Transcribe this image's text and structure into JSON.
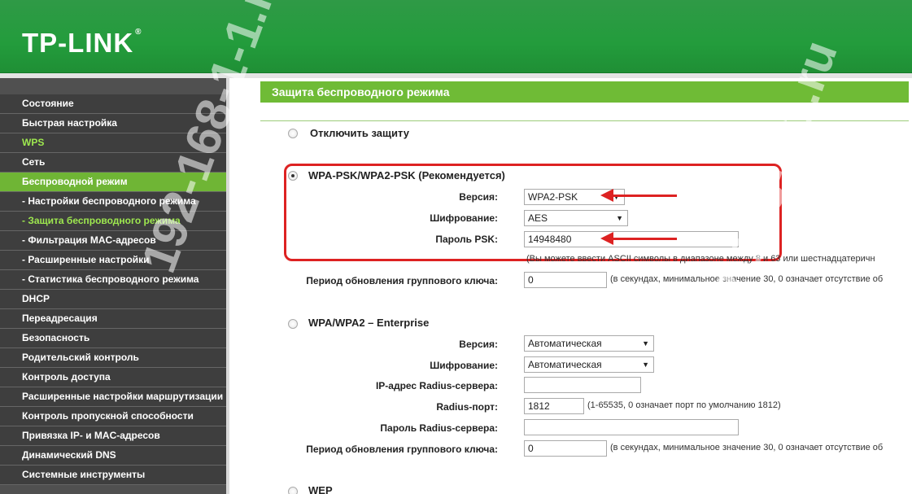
{
  "brand": {
    "logo": "TP-LINK",
    "trademark": "®"
  },
  "sidebar": {
    "items": [
      {
        "label": "Состояние"
      },
      {
        "label": "Быстрая настройка"
      },
      {
        "label": "WPS"
      },
      {
        "label": "Сеть"
      },
      {
        "label": "Беспроводной режим"
      },
      {
        "label": "- Настройки беспроводного режима"
      },
      {
        "label": "- Защита беспроводного режима"
      },
      {
        "label": "- Фильтрация MAC-адресов"
      },
      {
        "label": "- Расширенные настройки"
      },
      {
        "label": "- Статистика беспроводного режима"
      },
      {
        "label": "DHCP"
      },
      {
        "label": "Переадресация"
      },
      {
        "label": "Безопасность"
      },
      {
        "label": "Родительский контроль"
      },
      {
        "label": "Контроль доступа"
      },
      {
        "label": "Расширенные настройки маршрутизации"
      },
      {
        "label": "Контроль пропускной способности"
      },
      {
        "label": "Привязка IP- и MAC-адресов"
      },
      {
        "label": "Динамический DNS"
      },
      {
        "label": "Системные инструменты"
      }
    ]
  },
  "main": {
    "title": "Защита беспроводного режима",
    "disable": {
      "label": "Отключить защиту"
    },
    "wpa_psk": {
      "label": "WPA-PSK/WPA2-PSK (Рекомендуется)",
      "version_label": "Версия:",
      "version_value": "WPA2-PSK",
      "encryption_label": "Шифрование:",
      "encryption_value": "AES",
      "password_label": "Пароль PSK:",
      "password_value": "14948480",
      "password_hint": "(Вы можете ввести ASCII символы в диапазоне между 8 и 63 или шестнадцатеричн",
      "group_key_label": "Период обновления группового ключа:",
      "group_key_value": "0",
      "group_key_hint": "(в секундах, минимальное значение 30, 0 означает отсутствие об"
    },
    "enterprise": {
      "label": "WPA/WPA2 – Enterprise",
      "version_label": "Версия:",
      "version_value": "Автоматическая",
      "encryption_label": "Шифрование:",
      "encryption_value": "Автоматическая",
      "radius_ip_label": "IP-адрес Radius-сервера:",
      "radius_ip_value": "",
      "radius_port_label": "Radius-порт:",
      "radius_port_value": "1812",
      "radius_port_hint": "(1-65535, 0 означает порт по умолчанию 1812)",
      "radius_pass_label": "Пароль Radius-сервера:",
      "radius_pass_value": "",
      "group_key_label": "Период обновления группового ключа:",
      "group_key_value": "0",
      "group_key_hint": "(в секундах, минимальное значение 30, 0 означает отсутствие об"
    },
    "wep": {
      "label": "WEP"
    }
  },
  "watermark": "192-168-1-1.ru",
  "colors": {
    "header": "#239c3c",
    "accent": "#6fb535",
    "annotation": "#dd2222"
  }
}
